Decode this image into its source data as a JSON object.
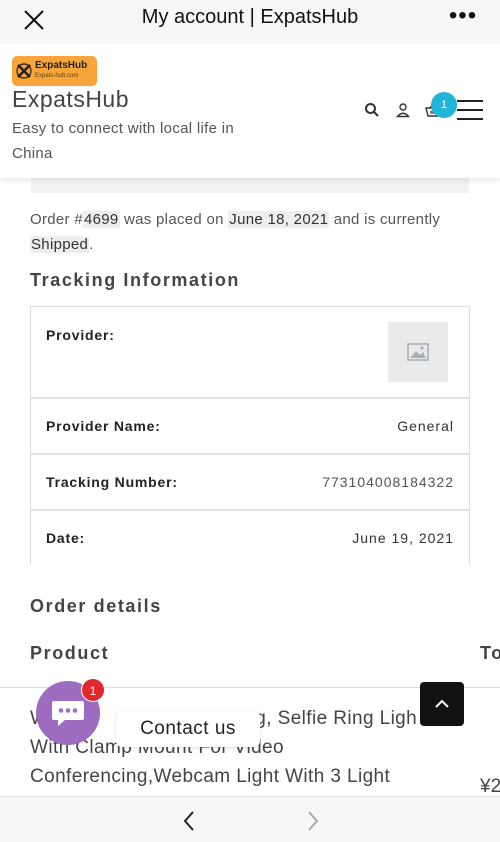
{
  "browser": {
    "title": "My account | ExpatsHub",
    "more_label": "•••"
  },
  "header": {
    "logo_text": "ExpatsHub",
    "logo_subtext": "Expats-hub.com",
    "site_name": "ExpatsHub",
    "tagline": "Easy to connect with local life in China",
    "cart_count": "1",
    "icons": [
      "search-icon",
      "user-icon",
      "cart-icon",
      "hamburger-menu-icon"
    ]
  },
  "order": {
    "prefix": "Order #",
    "number": "4699",
    "placed_on": " was placed on ",
    "date": "June 18, 2021",
    "currently": " and is currently ",
    "status": "Shipped",
    "suffix": "."
  },
  "tracking": {
    "heading": "Tracking Information",
    "rows": [
      {
        "label": "Provider:",
        "value": ""
      },
      {
        "label": "Provider Name:",
        "value": "General"
      },
      {
        "label": "Tracking Number:",
        "value": "773104008184322"
      },
      {
        "label": "Date:",
        "value": "June 19, 2021"
      }
    ]
  },
  "order_details": {
    "heading": "Order details",
    "col_product": "Product",
    "col_total": "To",
    "product_text": "With Clamp Mount For Video Conferencing,Webcam Light With 3 Light",
    "product_line1_left": "W",
    "product_line1_right": "ng, Selfie Ring Ligh",
    "price_visible": "¥2"
  },
  "floating": {
    "chat_badge": "1",
    "contact_label": "Contact us"
  },
  "colors": {
    "accent_cyan": "#20b5d6",
    "chat_purple": "#9d6cc0",
    "badge_red": "#e3262b",
    "logo_orange": "#f7a53a"
  }
}
